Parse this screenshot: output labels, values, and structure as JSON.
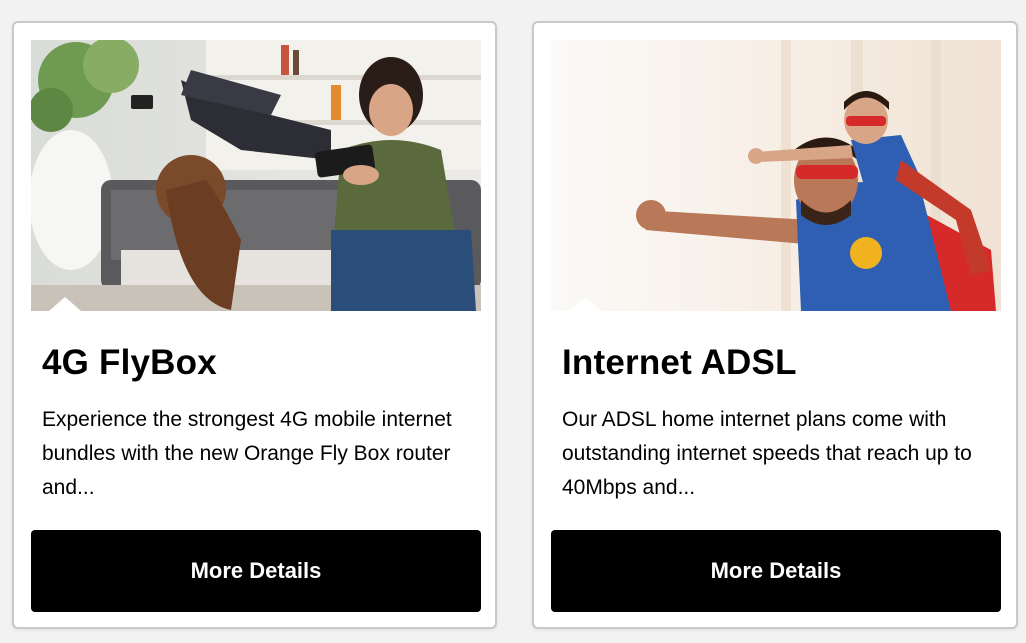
{
  "cards": [
    {
      "title": "4G FlyBox",
      "description": "Experience the strongest 4G mobile internet bundles with the new Orange Fly Box router and...",
      "button_label": "More Details",
      "image": "people-using-phones-photo"
    },
    {
      "title": "Internet ADSL",
      "description": "Our ADSL home internet plans come with outstanding internet speeds that reach up to 40Mbps and...",
      "button_label": "More Details",
      "image": "superhero-father-and-son-photo"
    }
  ]
}
